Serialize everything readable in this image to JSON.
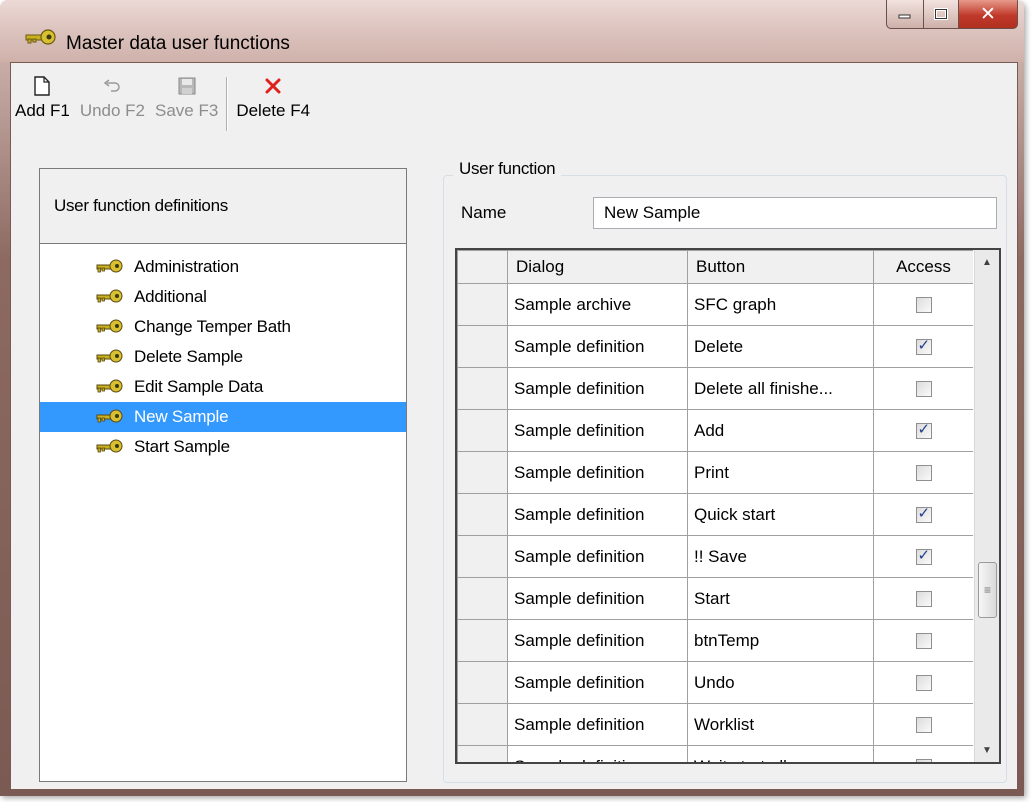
{
  "window": {
    "title": "Master data user functions",
    "title_icon": "key-icon"
  },
  "toolbar": {
    "add": "Add F1",
    "undo": "Undo F2",
    "save": "Save F3",
    "delete": "Delete F4"
  },
  "left_panel": {
    "header": "User function definitions",
    "items": [
      "Administration",
      "Additional",
      "Change Temper Bath",
      "Delete Sample",
      "Edit Sample Data",
      "New Sample",
      "Start Sample"
    ],
    "selected": "New Sample"
  },
  "user_function": {
    "group_title": "User function",
    "name_label": "Name",
    "name_value": "New Sample"
  },
  "grid": {
    "columns": [
      "Dialog",
      "Button",
      "Access"
    ],
    "rows": [
      {
        "dialog": "Sample archive",
        "button": "SFC graph",
        "access": false
      },
      {
        "dialog": "Sample definition",
        "button": "Delete",
        "access": true
      },
      {
        "dialog": "Sample definition",
        "button": "Delete all finishe...",
        "access": false
      },
      {
        "dialog": "Sample definition",
        "button": "Add",
        "access": true
      },
      {
        "dialog": "Sample definition",
        "button": "Print",
        "access": false
      },
      {
        "dialog": "Sample definition",
        "button": "Quick start",
        "access": true
      },
      {
        "dialog": "Sample definition",
        "button": "!! Save",
        "access": true
      },
      {
        "dialog": "Sample definition",
        "button": "Start",
        "access": false
      },
      {
        "dialog": "Sample definition",
        "button": "btnTemp",
        "access": false
      },
      {
        "dialog": "Sample definition",
        "button": "Undo",
        "access": false
      },
      {
        "dialog": "Sample definition",
        "button": "Worklist",
        "access": false
      },
      {
        "dialog": "Sample definition",
        "button": "Wait start all",
        "access": false
      }
    ]
  },
  "colors": {
    "selection": "#3399ff",
    "delete_icon": "#e0201a",
    "close_button": "#c0392b"
  }
}
